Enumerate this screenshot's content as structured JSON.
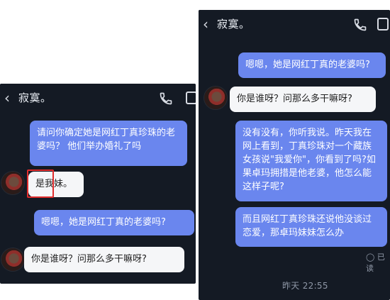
{
  "left": {
    "title": "寂寞。",
    "messages": [
      {
        "dir": "out",
        "text": "请问你确定她是网红丁真珍珠的老婆吗？ 他们举办婚礼了吗"
      },
      {
        "dir": "in",
        "text": "是我妹。"
      },
      {
        "dir": "out",
        "text": "嗯嗯，她是网红丁真的老婆吗?"
      },
      {
        "dir": "in",
        "text": "你是谁呀？问那么多干嘛呀?"
      }
    ]
  },
  "right": {
    "title": "寂寞。",
    "messages": [
      {
        "dir": "out",
        "text": "嗯嗯，她是网红丁真的老婆吗?"
      },
      {
        "dir": "in",
        "text": "你是谁呀？问那么多干嘛呀?"
      },
      {
        "dir": "out",
        "text": "没有没有，你听我说。昨天我在网上看到，丁真珍珠对一个藏族女孩说\"我爱你\"，你看到了吗?如果卓玛拥措是他老婆，他怎么能这样子呢?"
      },
      {
        "dir": "out",
        "text": "而且网红丁真珍珠还说他没谈过恋爱，那卓玛妹妹怎么办"
      }
    ],
    "read_status": "已读",
    "timestamp": "昨天 22:55"
  },
  "icons": {
    "back": "chevron-left-icon",
    "call": "phone-icon",
    "more": "square-icon",
    "read": "check-circle-icon"
  },
  "colors": {
    "background": "#141a24",
    "outgoing_bubble": "#6a86ee",
    "incoming_bubble": "#f5f6f8",
    "highlight": "#e12d2d"
  }
}
